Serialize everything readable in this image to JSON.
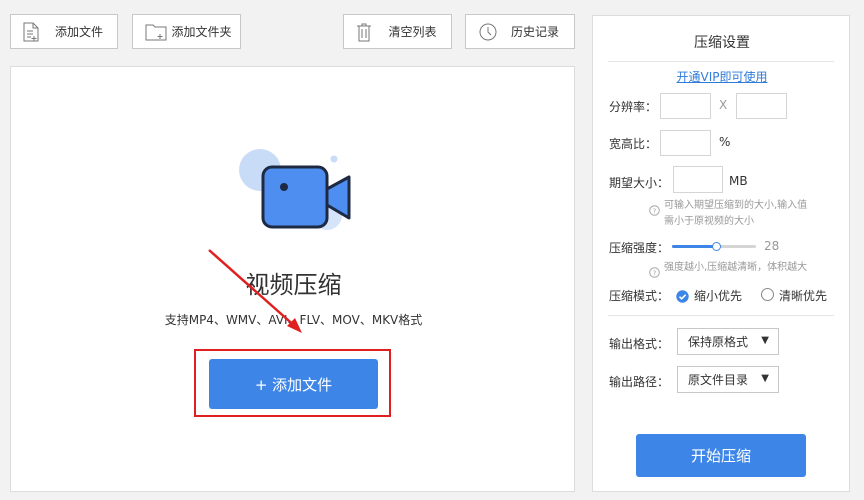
{
  "toolbar": {
    "add_file": "添加文件",
    "add_folder": "添加文件夹",
    "clear_list": "清空列表",
    "history": "历史记录"
  },
  "main": {
    "title": "视频压缩",
    "subtitle": "支持MP4、WMV、AVI、FLV、MOV、MKV格式",
    "add_button": "+ 添加文件"
  },
  "settings": {
    "title": "压缩设置",
    "vip_link": "开通VIP即可使用",
    "resolution_label": "分辨率：",
    "resolution_sep": "X",
    "aspect_label": "宽高比：",
    "aspect_unit": "%",
    "expected_size_label": "期望大小：",
    "expected_size_unit": "MB",
    "expected_hint_1": "可输入期望压缩到的大小,输入值",
    "expected_hint_2": "需小于原视频的大小",
    "strength_label": "压缩强度：",
    "strength_value": "28",
    "strength_fraction": 0.52,
    "strength_hint": "强度越小,压缩越清晰，体积越大",
    "mode_label": "压缩模式：",
    "mode_small": "缩小优先",
    "mode_clear": "清晰优先",
    "output_format_label": "输出格式：",
    "output_format_value": "保持原格式",
    "output_path_label": "输出路径：",
    "output_path_value": "原文件目录",
    "start_button": "开始压缩"
  },
  "colors": {
    "accent": "#3d86e8",
    "link": "#2f7bd9",
    "highlight": "#e02020"
  }
}
